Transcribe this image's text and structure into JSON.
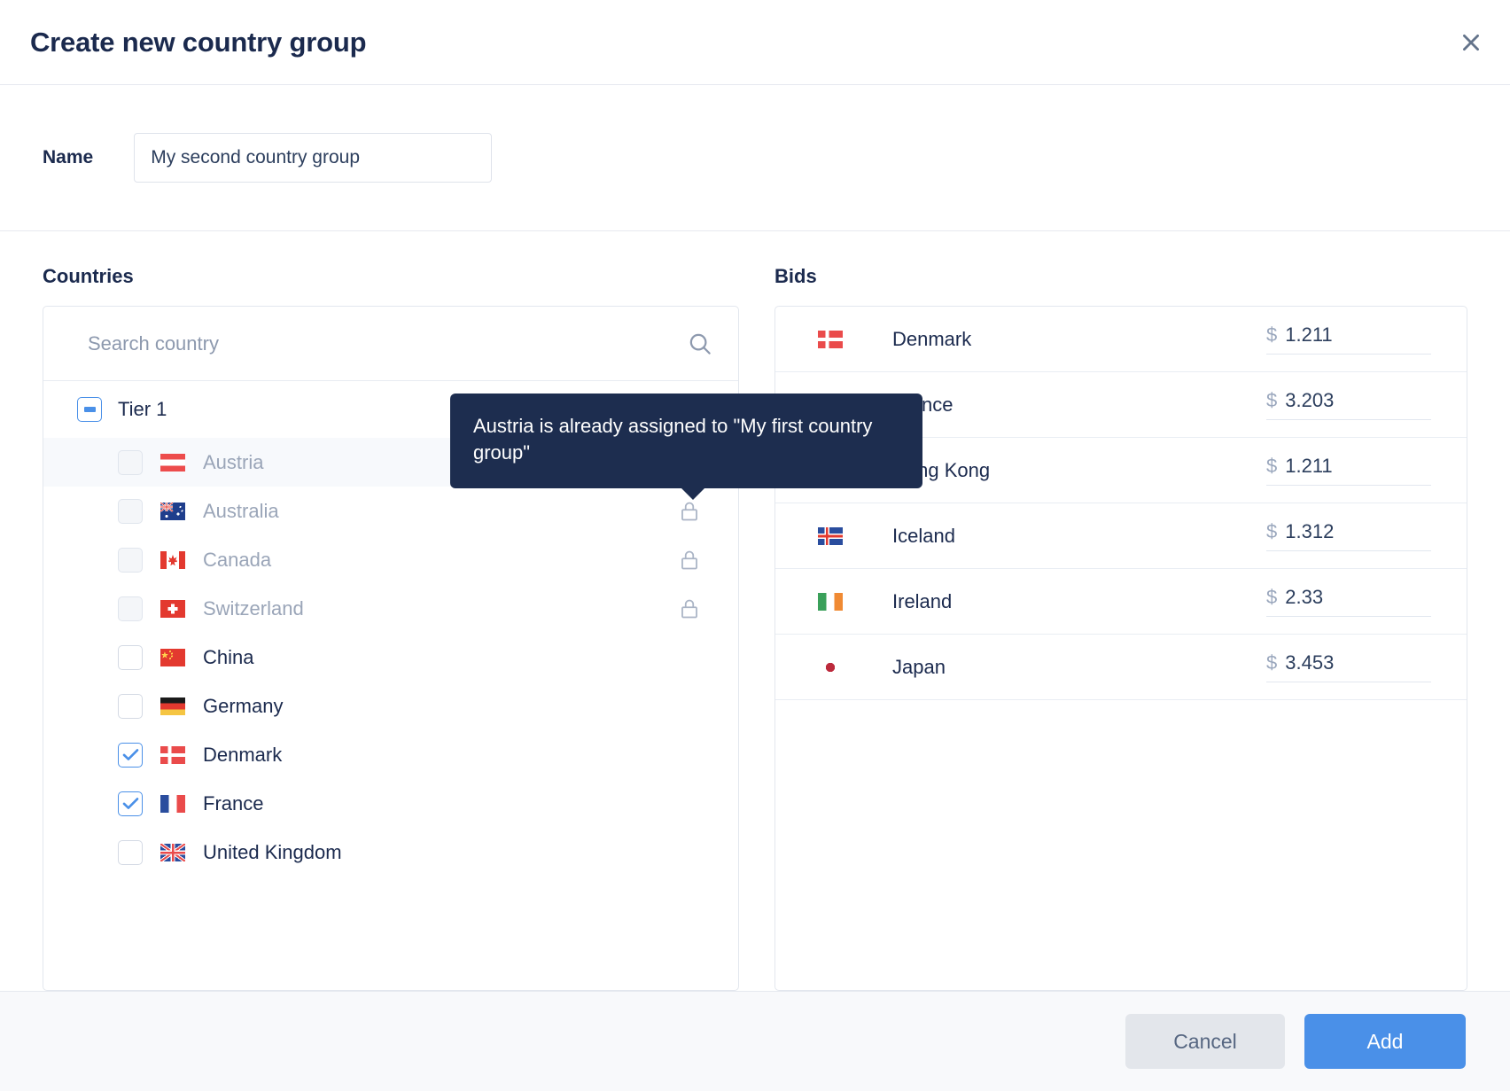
{
  "header": {
    "title": "Create new country group",
    "close_icon": "close-icon"
  },
  "name_field": {
    "label": "Name",
    "value": "My second country group",
    "placeholder": "Name"
  },
  "countries_panel": {
    "heading": "Countries",
    "search": {
      "placeholder": "Search country",
      "value": "",
      "icon": "search-icon"
    },
    "group": {
      "label": "Tier 1",
      "checkbox_state": "indeterminate"
    },
    "items": [
      {
        "name": "Austria",
        "flag": "at",
        "checked": false,
        "locked": true,
        "hovered": true,
        "clipped": false
      },
      {
        "name": "Australia",
        "flag": "au",
        "checked": false,
        "locked": true,
        "hovered": false,
        "clipped": false
      },
      {
        "name": "Canada",
        "flag": "ca",
        "checked": false,
        "locked": true,
        "hovered": false,
        "clipped": false
      },
      {
        "name": "Switzerland",
        "flag": "ch",
        "checked": false,
        "locked": true,
        "hovered": false,
        "clipped": false
      },
      {
        "name": "China",
        "flag": "cn",
        "checked": false,
        "locked": false,
        "hovered": false,
        "clipped": false
      },
      {
        "name": "Germany",
        "flag": "de",
        "checked": false,
        "locked": false,
        "hovered": false,
        "clipped": false
      },
      {
        "name": "Denmark",
        "flag": "dk",
        "checked": true,
        "locked": false,
        "hovered": false,
        "clipped": false
      },
      {
        "name": "France",
        "flag": "fr",
        "checked": true,
        "locked": false,
        "hovered": false,
        "clipped": false
      },
      {
        "name": "United Kingdom",
        "flag": "gb",
        "checked": false,
        "locked": false,
        "hovered": false,
        "clipped": true
      }
    ]
  },
  "bids_panel": {
    "heading": "Bids",
    "currency_symbol": "$",
    "rows": [
      {
        "country": "Denmark",
        "flag": "dk",
        "amount": "1.211"
      },
      {
        "country": "France",
        "flag": "fr",
        "amount": "3.203"
      },
      {
        "country": "Hong Kong",
        "flag": "hk",
        "amount": "1.211"
      },
      {
        "country": "Iceland",
        "flag": "is",
        "amount": "1.312"
      },
      {
        "country": "Ireland",
        "flag": "ie",
        "amount": "2.33"
      },
      {
        "country": "Japan",
        "flag": "jp",
        "amount": "3.453"
      }
    ]
  },
  "tooltip": {
    "text": "Austria is already assigned to \"My first country group\""
  },
  "footer": {
    "cancel_label": "Cancel",
    "add_label": "Add"
  },
  "colors": {
    "accent_blue": "#4a90e8",
    "title_navy": "#1b2a4e",
    "tooltip_bg": "#1d2d4f",
    "muted_text": "#9aa5b8",
    "footer_bg": "#f8f9fb"
  }
}
